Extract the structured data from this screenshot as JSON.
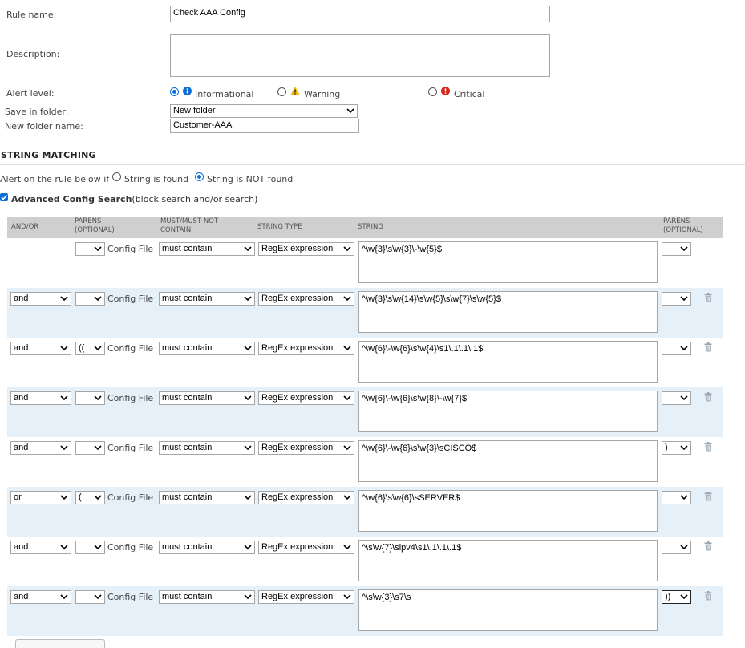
{
  "form": {
    "rule_name_label": "Rule name:",
    "rule_name_value": "Check AAA Config",
    "description_label": "Description:",
    "description_value": "",
    "alert_level_label": "Alert level:",
    "alert_levels": [
      {
        "label": "Informational",
        "selected": true,
        "icon": "info-icon"
      },
      {
        "label": "Warning",
        "selected": false,
        "icon": "warning-icon"
      },
      {
        "label": "Critical",
        "selected": false,
        "icon": "critical-icon"
      }
    ],
    "save_folder_label": "Save in folder:",
    "save_folder_value": "New folder",
    "new_folder_label": "New folder name:",
    "new_folder_value": "Customer-AAA"
  },
  "string_matching": {
    "title": "STRING MATCHING",
    "alert_prefix": "Alert on the rule below if",
    "option_found": "String is found",
    "option_not_found": "String is NOT found",
    "selected": "not_found",
    "advanced_label": "Advanced Config Search",
    "advanced_hint": "(block search and/or search)",
    "advanced_checked": true
  },
  "table": {
    "headers": {
      "andor": "AND/OR",
      "parens_open_1": "PARENS",
      "parens_open_2": "(OPTIONAL)",
      "must_1": "MUST/MUST NOT",
      "must_2": "CONTAIN",
      "string_type": "STRING TYPE",
      "string": "STRING",
      "parens_close_1": "PARENS",
      "parens_close_2": "(OPTIONAL)"
    },
    "config_file_label": "Config File",
    "rows": [
      {
        "andor": "",
        "open": "",
        "must": "must contain",
        "type": "RegEx expression",
        "string": "^\\w{3}\\s\\w{3}\\-\\w{5}$",
        "close": ""
      },
      {
        "andor": "and",
        "open": "",
        "must": "must contain",
        "type": "RegEx expression",
        "string": "^\\w{3}\\s\\w{14}\\s\\w{5}\\s\\w{7}\\s\\w{5}$",
        "close": ""
      },
      {
        "andor": "and",
        "open": "((",
        "must": "must contain",
        "type": "RegEx expression",
        "string": "^\\w{6}\\-\\w{6}\\s\\w{4}\\s1\\.1\\.1\\.1$",
        "close": ""
      },
      {
        "andor": "and",
        "open": "",
        "must": "must contain",
        "type": "RegEx expression",
        "string": "^\\w{6}\\-\\w{6}\\s\\w{8}\\-\\w{7}$",
        "close": ""
      },
      {
        "andor": "and",
        "open": "",
        "must": "must contain",
        "type": "RegEx expression",
        "string": "^\\w{6}\\-\\w{6}\\s\\w{3}\\sCISCO$",
        "close": ")"
      },
      {
        "andor": "or",
        "open": "(",
        "must": "must contain",
        "type": "RegEx expression",
        "string": "^\\w{6}\\s\\w{6}\\sSERVER$",
        "close": ""
      },
      {
        "andor": "and",
        "open": "",
        "must": "must contain",
        "type": "RegEx expression",
        "string": "^\\s\\w{7}\\sipv4\\s1\\.1\\.1\\.1$",
        "close": ""
      },
      {
        "andor": "and",
        "open": "",
        "must": "must contain",
        "type": "RegEx expression",
        "string": "^\\s\\w{3}\\s7\\s",
        "close": "))"
      }
    ]
  },
  "colors": {
    "accent": "#0a6fd6",
    "row_alt": "#e6f0f8",
    "header_bg": "#cfcfcf",
    "warning": "#f2b600",
    "critical": "#d9261c"
  }
}
